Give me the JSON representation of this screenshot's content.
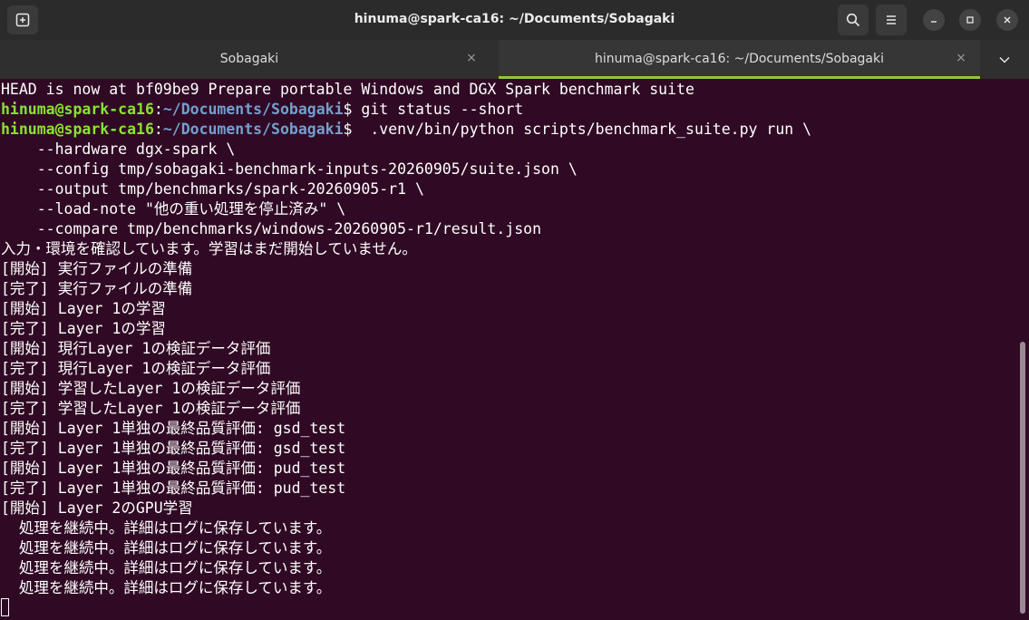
{
  "window": {
    "title": "hinuma@spark-ca16: ~/Documents/Sobagaki",
    "buttons": {
      "new_tab_icon": "new-tab-icon",
      "search_icon": "search-icon",
      "menu_icon": "hamburger-menu-icon",
      "minimize_icon": "minimize-icon",
      "maximize_icon": "maximize-icon",
      "close_icon": "close-icon"
    }
  },
  "tabs": [
    {
      "label": "Sobagaki",
      "active": false,
      "close": "×"
    },
    {
      "label": "hinuma@spark-ca16: ~/Documents/Sobagaki",
      "active": true,
      "close": "×"
    }
  ],
  "tab_dropdown_icon": "chevron-down-icon",
  "colors": {
    "background": "#300a24",
    "prompt_user": "#8ae234",
    "prompt_path": "#729fcf",
    "active_tab_indicator": "#8fc93a",
    "text": "#ffffff"
  },
  "terminal": {
    "head_line": "HEAD is now at bf09be9 Prepare portable Windows and DGX Spark benchmark suite",
    "prompt1": {
      "user": "hinuma@spark-ca16",
      "sep": ":",
      "path": "~/Documents/Sobagaki",
      "dollar": "$",
      "command": " git status --short"
    },
    "prompt2": {
      "user": "hinuma@spark-ca16",
      "sep": ":",
      "path": "~/Documents/Sobagaki",
      "dollar": "$",
      "command": "  .venv/bin/python scripts/benchmark_suite.py run \\"
    },
    "lines": [
      "    --hardware dgx-spark \\",
      "    --config tmp/sobagaki-benchmark-inputs-20260905/suite.json \\",
      "    --output tmp/benchmarks/spark-20260905-r1 \\",
      "    --load-note \"他の重い処理を停止済み\" \\",
      "    --compare tmp/benchmarks/windows-20260905-r1/result.json",
      "入力・環境を確認しています。学習はまだ開始していません。",
      "[開始] 実行ファイルの準備",
      "[完了] 実行ファイルの準備",
      "[開始] Layer 1の学習",
      "[完了] Layer 1の学習",
      "[開始] 現行Layer 1の検証データ評価",
      "[完了] 現行Layer 1の検証データ評価",
      "[開始] 学習したLayer 1の検証データ評価",
      "[完了] 学習したLayer 1の検証データ評価",
      "[開始] Layer 1単独の最終品質評価: gsd_test",
      "[完了] Layer 1単独の最終品質評価: gsd_test",
      "[開始] Layer 1単独の最終品質評価: pud_test",
      "[完了] Layer 1単独の最終品質評価: pud_test",
      "[開始] Layer 2のGPU学習",
      "  処理を継続中。詳細はログに保存しています。",
      "  処理を継続中。詳細はログに保存しています。",
      "  処理を継続中。詳細はログに保存しています。",
      "  処理を継続中。詳細はログに保存しています。"
    ]
  }
}
